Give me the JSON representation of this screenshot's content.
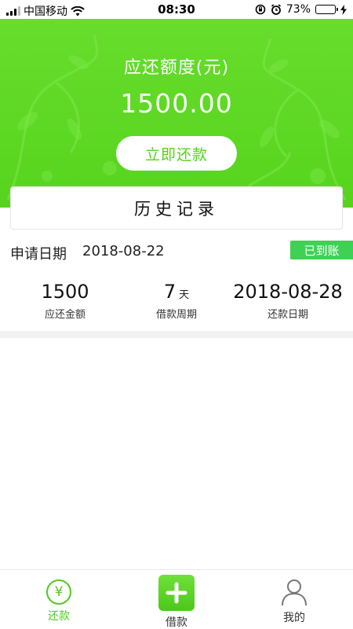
{
  "status_bar": {
    "carrier": "中国移动",
    "time": "08:30",
    "battery_percent": "73%",
    "battery_level": 0.73
  },
  "hero": {
    "title": "应还额度(元)",
    "amount": "1500.00",
    "repay_button": "立即还款"
  },
  "history": {
    "title": "历史记录"
  },
  "record": {
    "apply_label": "申请日期",
    "apply_date": "2018-08-22",
    "status": "已到账",
    "stats": [
      {
        "value": "1500",
        "unit": "",
        "label": "应还金额"
      },
      {
        "value": "7",
        "unit": "天",
        "label": "借款周期"
      },
      {
        "value": "2018-08-28",
        "unit": "",
        "label": "还款日期"
      }
    ]
  },
  "tabbar": {
    "repay": {
      "label": "还款",
      "icon": "yen-icon"
    },
    "borrow": {
      "label": "借款",
      "icon": "plus-icon"
    },
    "mine": {
      "label": "我的",
      "icon": "person-icon"
    }
  },
  "colors": {
    "accent": "#55d21a",
    "status_badge": "#3fd154"
  }
}
